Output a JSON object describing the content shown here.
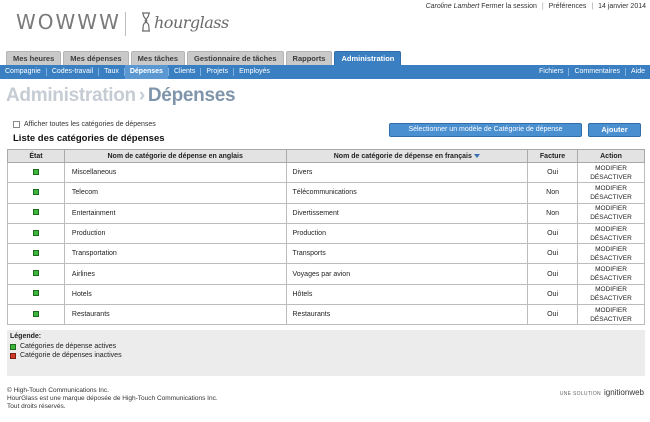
{
  "header": {
    "logo_left": "WOWWW",
    "logo_right": "hourglass",
    "user": "Caroline Lambert",
    "logout": "Fermer la session",
    "preferences": "Préférences",
    "date": "14 janvier 2014"
  },
  "tabs": [
    {
      "label": "Mes heures",
      "active": false
    },
    {
      "label": "Mes dépenses",
      "active": false
    },
    {
      "label": "Mes tâches",
      "active": false
    },
    {
      "label": "Gestionnaire de tâches",
      "active": false
    },
    {
      "label": "Rapports",
      "active": false
    },
    {
      "label": "Administration",
      "active": true
    }
  ],
  "subnav": {
    "left": [
      {
        "label": "Compagnie",
        "active": false
      },
      {
        "label": "Codes-travail",
        "active": false
      },
      {
        "label": "Taux",
        "active": false
      },
      {
        "label": "Dépenses",
        "active": true
      },
      {
        "label": "Clients",
        "active": false
      },
      {
        "label": "Projets",
        "active": false
      },
      {
        "label": "Employés",
        "active": false
      }
    ],
    "right": [
      {
        "label": "Fichiers"
      },
      {
        "label": "Commentaires"
      },
      {
        "label": "Aide"
      }
    ]
  },
  "page": {
    "crumb": "Administration",
    "arrow": "›",
    "title": "Dépenses",
    "show_all_label": "Afficher toutes les catégories de dépenses",
    "section_title": "Liste des catégories de dépenses",
    "select_model_button": "Sélectionner un modèle de Catégorie de dépense",
    "add_button": "Ajouter"
  },
  "table": {
    "headers": {
      "state": "État",
      "name_en": "Nom de catégorie de dépense en anglais",
      "name_fr": "Nom de catégorie de dépense en français",
      "invoice": "Facture",
      "action": "Action"
    },
    "rows": [
      {
        "en": "Miscellaneous",
        "fr": "Divers",
        "invoice": "Oui",
        "active": true
      },
      {
        "en": "Telecom",
        "fr": "Télécommunications",
        "invoice": "Non",
        "active": true
      },
      {
        "en": "Entertainment",
        "fr": "Divertissement",
        "invoice": "Non",
        "active": true
      },
      {
        "en": "Production",
        "fr": "Production",
        "invoice": "Oui",
        "active": true
      },
      {
        "en": "Transportation",
        "fr": "Transports",
        "invoice": "Oui",
        "active": true
      },
      {
        "en": "Airlines",
        "fr": "Voyages par avion",
        "invoice": "Oui",
        "active": true
      },
      {
        "en": "Hotels",
        "fr": "Hôtels",
        "invoice": "Oui",
        "active": true
      },
      {
        "en": "Restaurants",
        "fr": "Restaurants",
        "invoice": "Oui",
        "active": true
      }
    ],
    "modify_label": "MODIFIER",
    "deactivate_label": "DÉSACTIVER"
  },
  "legend": {
    "title": "Légende:",
    "active": "Catégories de dépense actives",
    "inactive": "Catégorie de dépenses inactives"
  },
  "colors": {
    "active": "#3cb63c",
    "inactive": "#d23a2a",
    "accent": "#3a7fc1"
  },
  "footer": {
    "line1": "© High-Touch Communications Inc.",
    "line2": "HourGlass est une marque déposée de High-Touch Communications Inc.",
    "line3": "Tout droits réservés.",
    "brand_prefix": "UNE SOLUTION",
    "brand": "ignitionweb"
  }
}
